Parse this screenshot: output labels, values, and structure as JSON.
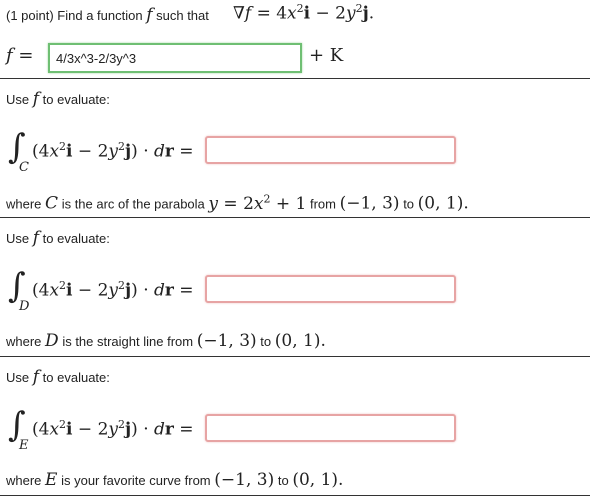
{
  "header": {
    "points": "(1 point) Find a function",
    "f_symbol": "f",
    "such_that": "such that",
    "gradient_equation": "∇f = 4x²i − 2y²j."
  },
  "potential": {
    "f_equals": "f =",
    "input_value": "4/3x^3-2/3y^3",
    "plus_k": "+ K"
  },
  "sections": [
    {
      "use_text_a": "Use",
      "use_f": "f",
      "use_text_b": "to evaluate:",
      "integral_subscript": "C",
      "integrand": "(4x²i − 2y²j) · dr =",
      "input_value": "",
      "where_text": "where",
      "curve_letter": "C",
      "description_a": "is the arc of the parabola",
      "parabola": "y = 2x² + 1",
      "from_text": "from",
      "start_point": "(−1, 3)",
      "to_text": "to",
      "end_point": "(0, 1)."
    },
    {
      "use_text_a": "Use",
      "use_f": "f",
      "use_text_b": "to evaluate:",
      "integral_subscript": "D",
      "integrand": "(4x²i − 2y²j) · dr =",
      "input_value": "",
      "where_text": "where",
      "curve_letter": "D",
      "description_a": "is the straight line from",
      "start_point": "(−1, 3)",
      "to_text": "to",
      "end_point": "(0, 1)."
    },
    {
      "use_text_a": "Use",
      "use_f": "f",
      "use_text_b": "to evaluate:",
      "integral_subscript": "E",
      "integrand": "(4x²i − 2y²j) · dr =",
      "input_value": "",
      "where_text": "where",
      "curve_letter": "E",
      "description_a": "is your favorite curve from",
      "start_point": "(−1, 3)",
      "to_text": "to",
      "end_point": "(0, 1)."
    }
  ],
  "colors": {
    "correct_border": "#6fbf73",
    "incorrect_border": "#e7a4a4",
    "rule": "#333333"
  }
}
